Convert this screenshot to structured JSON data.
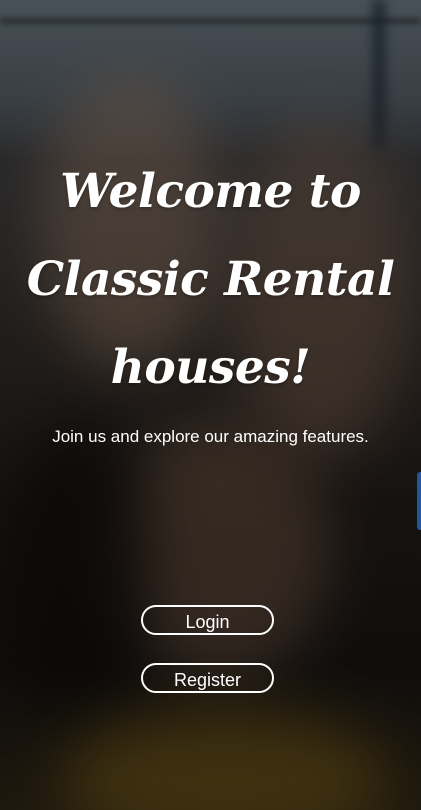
{
  "hero": {
    "title_line1": "Welcome to",
    "title_line2": "Classic Rental",
    "title_line3": "houses!",
    "subtitle": "Join us and explore our amazing features."
  },
  "actions": {
    "login_label": "Login",
    "register_label": "Register"
  },
  "colors": {
    "text": "#ffffff",
    "button_border": "#ffffff",
    "edge_tab": "#2d7ad6"
  }
}
